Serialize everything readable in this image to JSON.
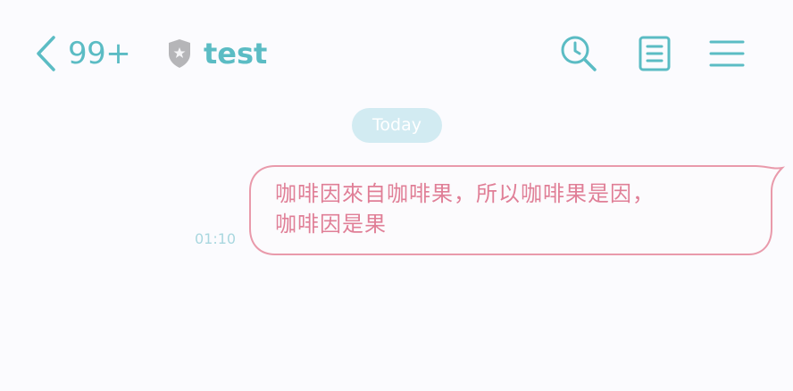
{
  "header": {
    "unread_count": "99+",
    "chat_title": "test",
    "icons": {
      "back": "chevron-left-icon",
      "badge": "shield-icon",
      "search": "search-icon",
      "notes": "notes-icon",
      "menu": "menu-icon"
    }
  },
  "chat": {
    "date_chip": "Today",
    "messages": [
      {
        "time": "01:10",
        "text_line1": "咖啡因來自咖啡果，所以咖啡果是因，",
        "text_line2": "咖啡因是果"
      }
    ]
  },
  "colors": {
    "accent": "#5bbcc4",
    "bubble_border": "#e99aab",
    "bubble_text": "#e07f97",
    "date_chip_bg": "#d2ebf2",
    "time_text": "#a9d7df",
    "background": "#fbfbfe",
    "badge_gray": "#b5b5b8"
  }
}
